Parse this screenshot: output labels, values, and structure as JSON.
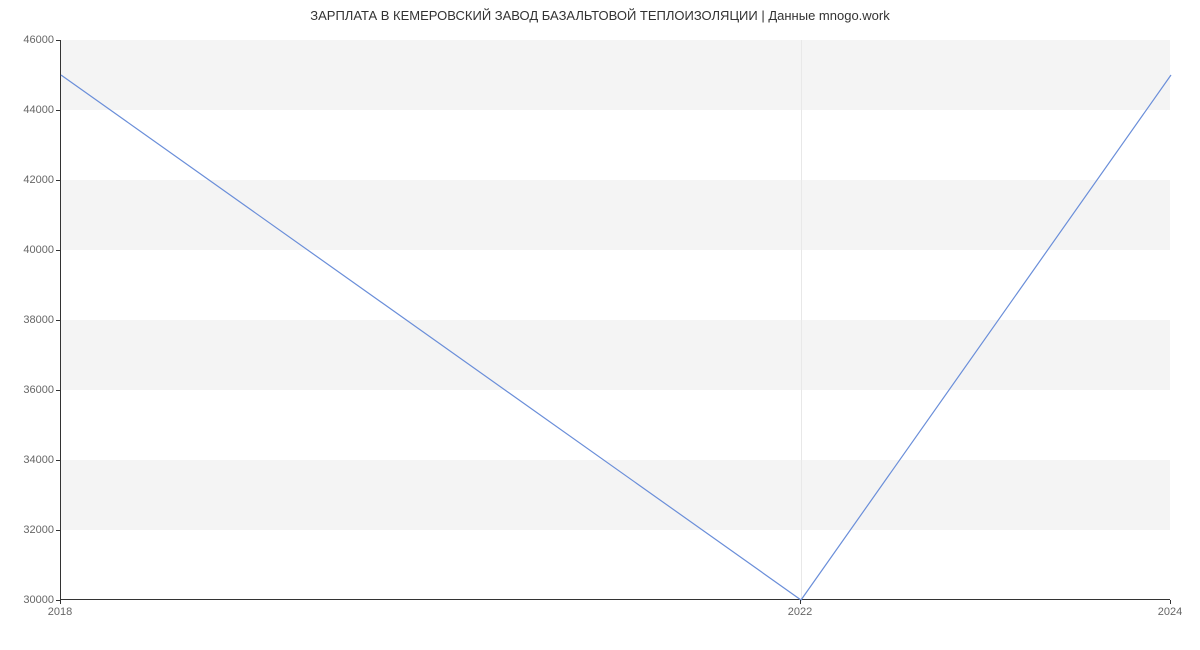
{
  "chart_data": {
    "type": "line",
    "title": "ЗАРПЛАТА В КЕМЕРОВСКИЙ ЗАВОД БАЗАЛЬТОВОЙ ТЕПЛОИЗОЛЯЦИИ | Данные mnogo.work",
    "x": [
      2018,
      2022,
      2024
    ],
    "values": [
      45000,
      30000,
      45000
    ],
    "xlabel": "",
    "ylabel": "",
    "xlim": [
      2018,
      2024
    ],
    "ylim": [
      30000,
      46000
    ],
    "xticks": [
      2018,
      2022,
      2024
    ],
    "yticks": [
      30000,
      32000,
      34000,
      36000,
      38000,
      40000,
      42000,
      44000,
      46000
    ],
    "line_color": "#6a8ed9"
  }
}
